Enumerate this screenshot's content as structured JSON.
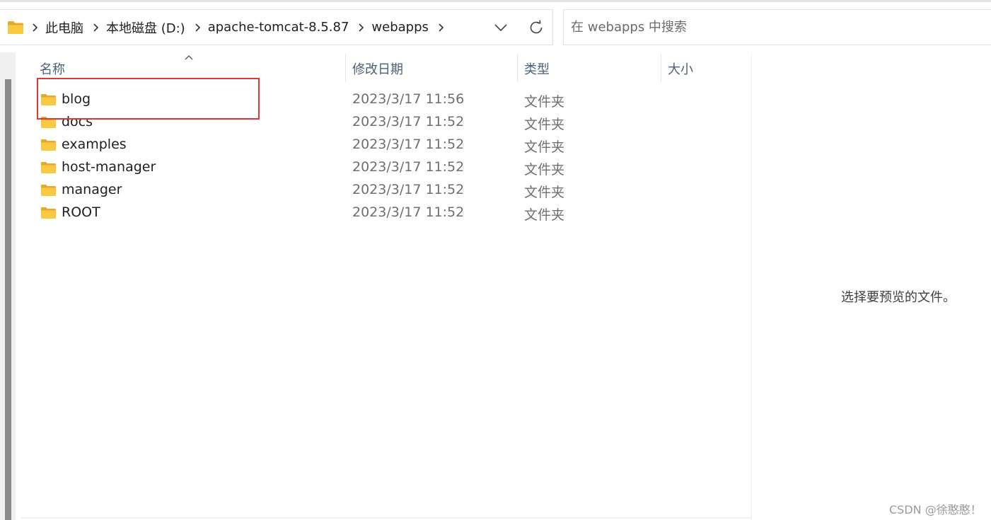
{
  "address_bar": {
    "breadcrumbs": [
      {
        "label": "此电脑"
      },
      {
        "label": "本地磁盘 (D:)"
      },
      {
        "label": "apache-tomcat-8.5.87"
      },
      {
        "label": "webapps"
      }
    ],
    "icons": {
      "folder": "folder-icon",
      "separator": "chevron-right-icon",
      "dropdown": "chevron-down-icon",
      "refresh": "refresh-icon"
    }
  },
  "search": {
    "placeholder": "在 webapps 中搜索",
    "value": ""
  },
  "file_list": {
    "columns": {
      "name": "名称",
      "modified": "修改日期",
      "type": "类型",
      "size": "大小"
    },
    "sort": {
      "column": "name",
      "direction": "ascending",
      "icon": "sort-caret-up-icon"
    },
    "rows": [
      {
        "name": "blog",
        "modified": "2023/3/17 11:56",
        "type": "文件夹",
        "size": "",
        "highlighted": true
      },
      {
        "name": "docs",
        "modified": "2023/3/17 11:52",
        "type": "文件夹",
        "size": ""
      },
      {
        "name": "examples",
        "modified": "2023/3/17 11:52",
        "type": "文件夹",
        "size": ""
      },
      {
        "name": "host-manager",
        "modified": "2023/3/17 11:52",
        "type": "文件夹",
        "size": ""
      },
      {
        "name": "manager",
        "modified": "2023/3/17 11:52",
        "type": "文件夹",
        "size": ""
      },
      {
        "name": "ROOT",
        "modified": "2023/3/17 11:52",
        "type": "文件夹",
        "size": ""
      }
    ]
  },
  "preview": {
    "message": "选择要预览的文件。"
  },
  "watermark": "CSDN @徐憨憨！",
  "colors": {
    "highlight_border": "#e0363b",
    "header_text": "#4c607a",
    "folder_yellow": "#f8c93e"
  }
}
